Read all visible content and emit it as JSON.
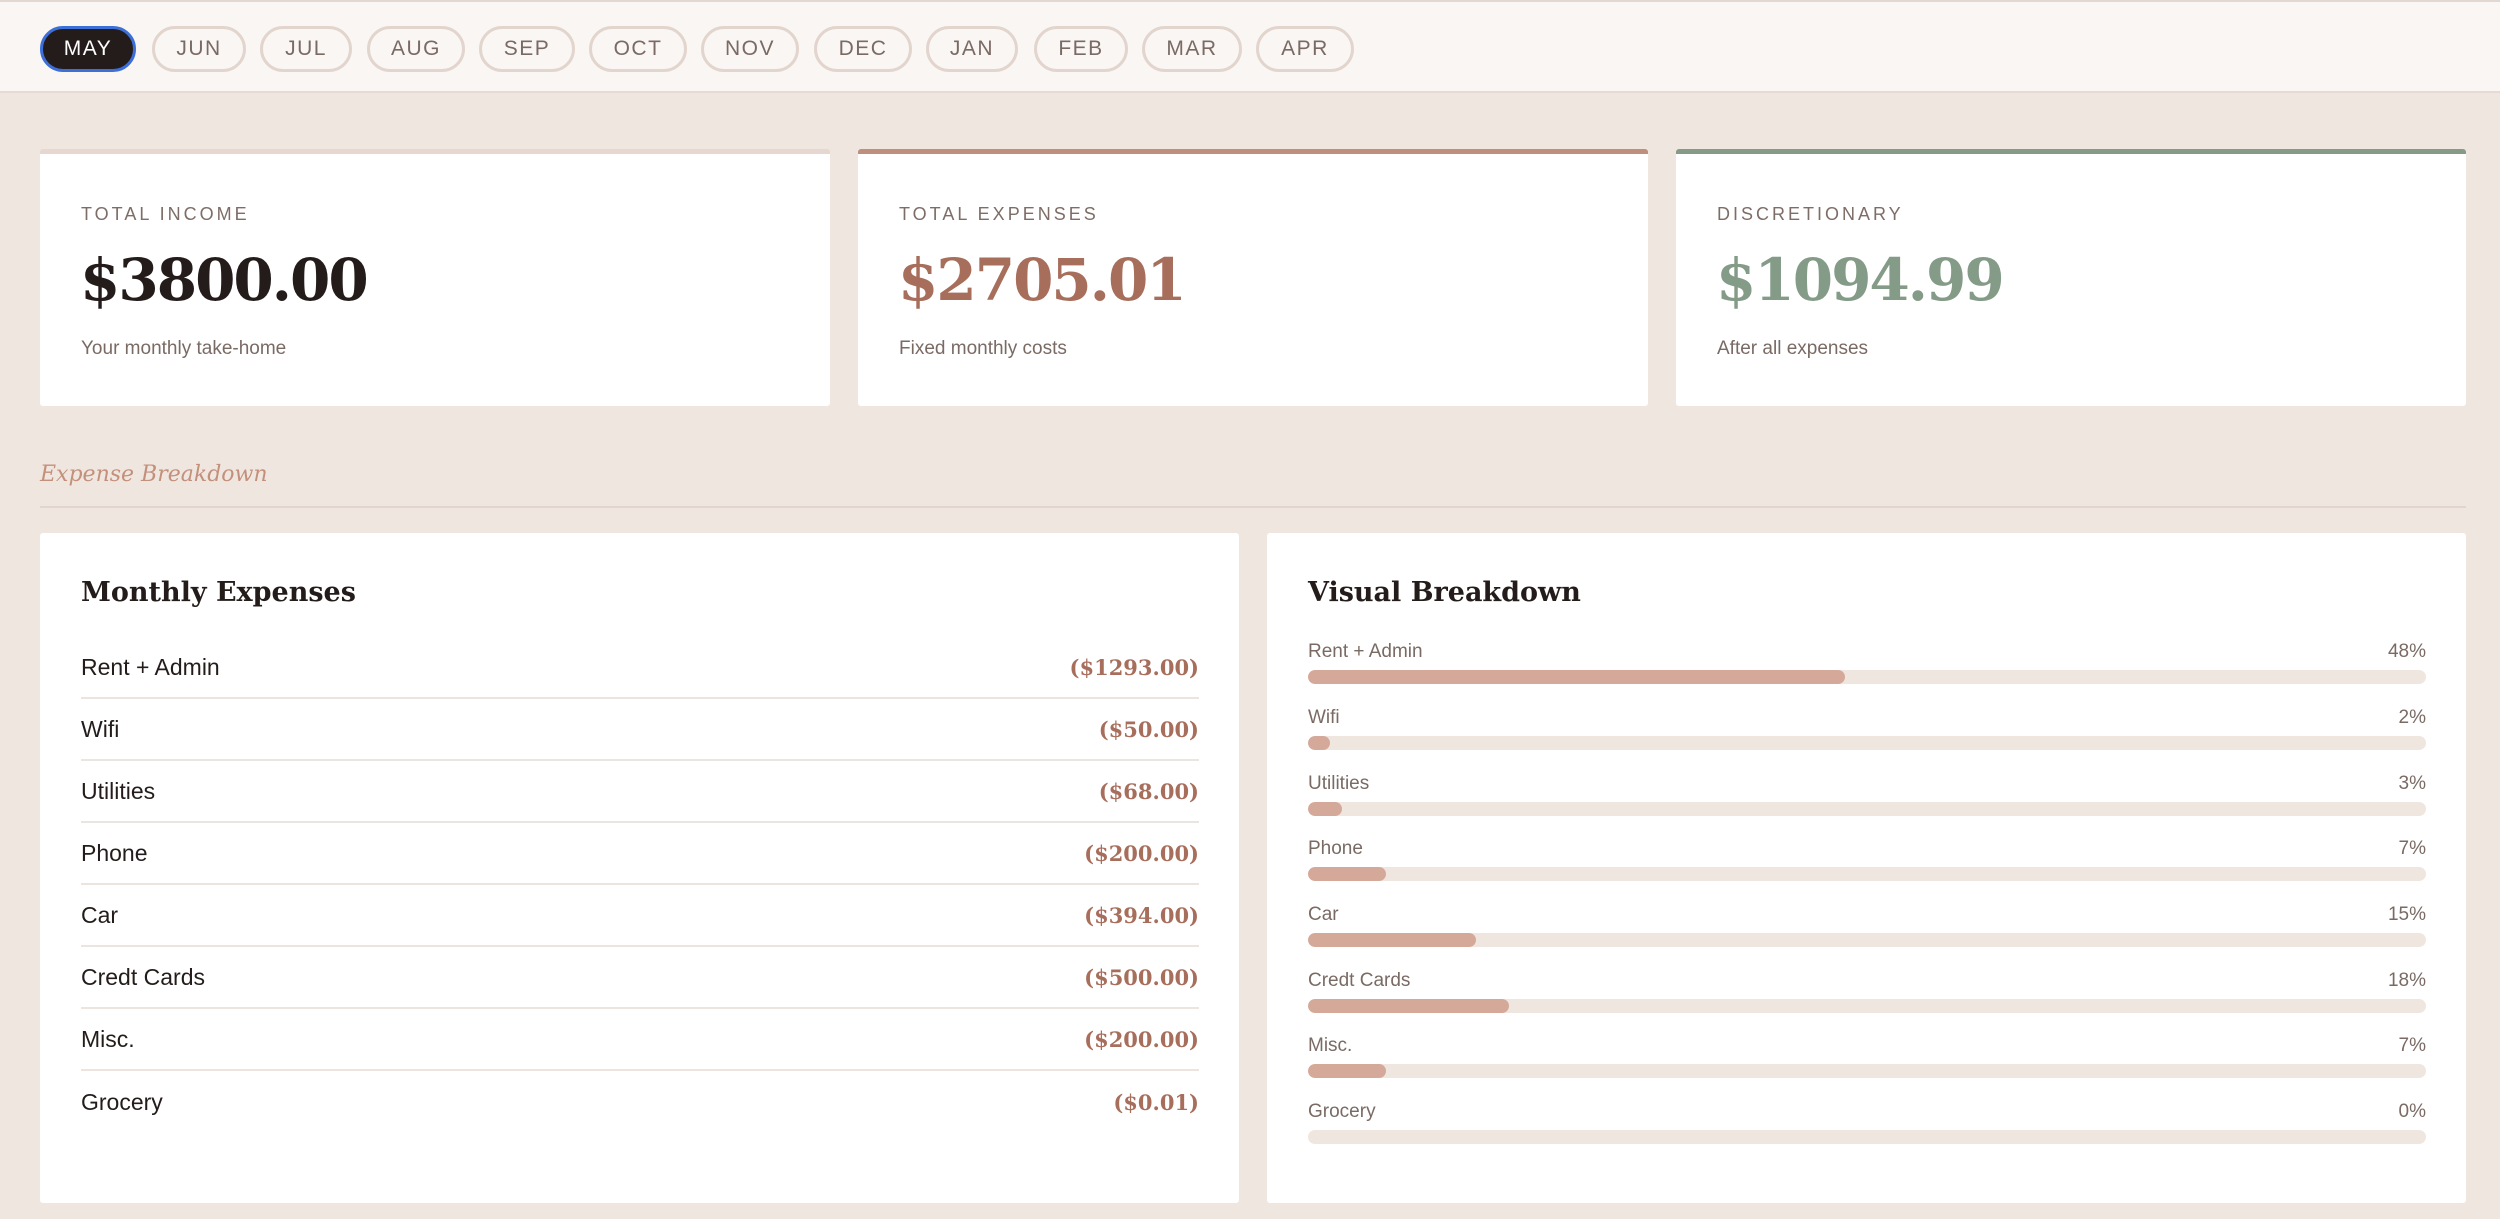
{
  "months": [
    "MAY",
    "JUN",
    "JUL",
    "AUG",
    "SEP",
    "OCT",
    "NOV",
    "DEC",
    "JAN",
    "FEB",
    "MAR",
    "APR"
  ],
  "active_month": "MAY",
  "summary": {
    "income": {
      "label": "TOTAL INCOME",
      "value": "$3800.00",
      "sub": "Your monthly take-home"
    },
    "expenses": {
      "label": "TOTAL EXPENSES",
      "value": "$2705.01",
      "sub": "Fixed monthly costs"
    },
    "discretionary": {
      "label": "DISCRETIONARY",
      "value": "$1094.99",
      "sub": "After all expenses"
    }
  },
  "section_title": "Expense Breakdown",
  "monthly_expenses": {
    "title": "Monthly Expenses",
    "items": [
      {
        "name": "Rent + Admin",
        "amount": "($1293.00)"
      },
      {
        "name": "Wifi",
        "amount": "($50.00)"
      },
      {
        "name": "Utilities",
        "amount": "($68.00)"
      },
      {
        "name": "Phone",
        "amount": "($200.00)"
      },
      {
        "name": "Car",
        "amount": "($394.00)"
      },
      {
        "name": "Credt Cards",
        "amount": "($500.00)"
      },
      {
        "name": "Misc.",
        "amount": "($200.00)"
      },
      {
        "name": "Grocery",
        "amount": "($0.01)"
      }
    ]
  },
  "visual_breakdown": {
    "title": "Visual Breakdown",
    "items": [
      {
        "name": "Rent + Admin",
        "pct_label": "48%",
        "pct": 48
      },
      {
        "name": "Wifi",
        "pct_label": "2%",
        "pct": 2
      },
      {
        "name": "Utilities",
        "pct_label": "3%",
        "pct": 3
      },
      {
        "name": "Phone",
        "pct_label": "7%",
        "pct": 7
      },
      {
        "name": "Car",
        "pct_label": "15%",
        "pct": 15
      },
      {
        "name": "Credt Cards",
        "pct_label": "18%",
        "pct": 18
      },
      {
        "name": "Misc.",
        "pct_label": "7%",
        "pct": 7
      },
      {
        "name": "Grocery",
        "pct_label": "0%",
        "pct": 0
      }
    ]
  },
  "colors": {
    "background": "#f0e6e0",
    "income_accent": "#e6d8d0",
    "expense_accent": "#bf8e7d",
    "discretionary_accent": "#869a88",
    "bar_fill": "#d4a99a",
    "active_month_ring": "#3c6fd8"
  }
}
